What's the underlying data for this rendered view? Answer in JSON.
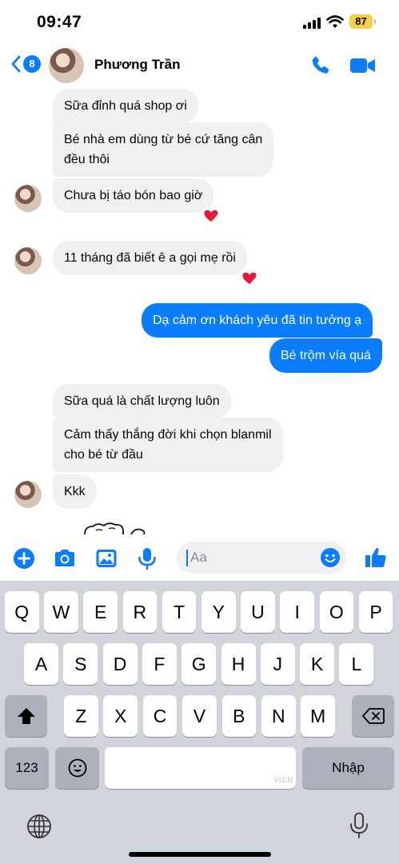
{
  "status_bar": {
    "time": "09:47",
    "battery": "87"
  },
  "header": {
    "back_count": "8",
    "contact_name": "Phương Trần"
  },
  "messages": [
    {
      "text": "Sữa đỉnh quá shop ơi"
    },
    {
      "text": "Bé nhà em dùng từ bé cứ tăng cân",
      "text2": "đều thôi"
    },
    {
      "text": "Chưa bị táo bón bao giờ"
    },
    {
      "text": "11 tháng đã biết ê a gọi mẹ rồi"
    },
    {
      "text": "Dạ cảm ơn khách yêu đã tin tưởng ạ"
    },
    {
      "text": "Bé trộm vía quá"
    },
    {
      "text": "Sữa quá là chất lượng luôn"
    },
    {
      "text": "Cảm thấy thắng đời khi chọn blanmil",
      "text2": "cho bé từ đầu"
    },
    {
      "text": "Kkk"
    }
  ],
  "reactions": {
    "heart": "❤"
  },
  "composer": {
    "placeholder": "Aa"
  },
  "keyboard": {
    "row1": [
      "Q",
      "W",
      "E",
      "R",
      "T",
      "Y",
      "U",
      "I",
      "O",
      "P"
    ],
    "row2": [
      "A",
      "S",
      "D",
      "F",
      "G",
      "H",
      "J",
      "K",
      "L"
    ],
    "row3": [
      "Z",
      "X",
      "C",
      "V",
      "B",
      "N",
      "M"
    ],
    "numbers_key": "123",
    "return_key": "Nhập",
    "watermark": "VIEN"
  },
  "icons": {
    "back": "chevron-left-icon",
    "call": "phone-icon",
    "video": "video-camera-icon",
    "plus": "plus-circle-icon",
    "camera": "camera-icon",
    "gallery": "image-icon",
    "mic": "microphone-icon",
    "emoji": "smiley-icon",
    "like": "thumbs-up-icon",
    "shift": "shift-icon",
    "delete": "backspace-icon",
    "globe": "globe-icon",
    "dictation": "microphone-icon"
  },
  "colors": {
    "accent": "#0a7cff",
    "incoming_bubble": "#f0f0f3",
    "keyboard_bg": "#d1d4db",
    "battery": "#f7cf46"
  }
}
